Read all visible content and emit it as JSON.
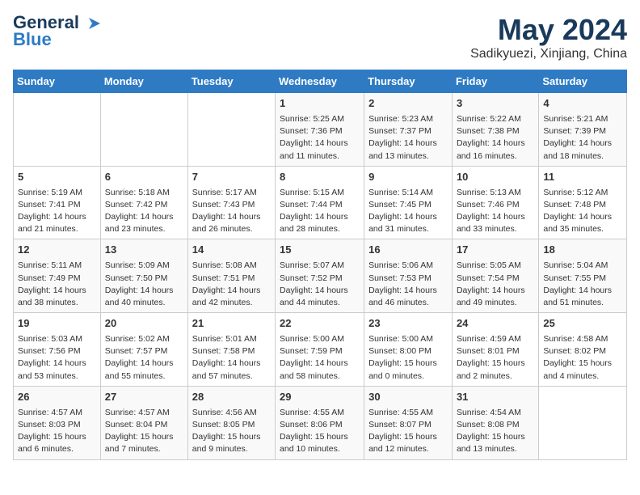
{
  "header": {
    "logo_line1": "General",
    "logo_line2": "Blue",
    "title": "May 2024",
    "location": "Sadikyuezi, Xinjiang, China"
  },
  "calendar": {
    "days_of_week": [
      "Sunday",
      "Monday",
      "Tuesday",
      "Wednesday",
      "Thursday",
      "Friday",
      "Saturday"
    ],
    "weeks": [
      [
        {
          "day": "",
          "info": ""
        },
        {
          "day": "",
          "info": ""
        },
        {
          "day": "",
          "info": ""
        },
        {
          "day": "1",
          "info": "Sunrise: 5:25 AM\nSunset: 7:36 PM\nDaylight: 14 hours\nand 11 minutes."
        },
        {
          "day": "2",
          "info": "Sunrise: 5:23 AM\nSunset: 7:37 PM\nDaylight: 14 hours\nand 13 minutes."
        },
        {
          "day": "3",
          "info": "Sunrise: 5:22 AM\nSunset: 7:38 PM\nDaylight: 14 hours\nand 16 minutes."
        },
        {
          "day": "4",
          "info": "Sunrise: 5:21 AM\nSunset: 7:39 PM\nDaylight: 14 hours\nand 18 minutes."
        }
      ],
      [
        {
          "day": "5",
          "info": "Sunrise: 5:19 AM\nSunset: 7:41 PM\nDaylight: 14 hours\nand 21 minutes."
        },
        {
          "day": "6",
          "info": "Sunrise: 5:18 AM\nSunset: 7:42 PM\nDaylight: 14 hours\nand 23 minutes."
        },
        {
          "day": "7",
          "info": "Sunrise: 5:17 AM\nSunset: 7:43 PM\nDaylight: 14 hours\nand 26 minutes."
        },
        {
          "day": "8",
          "info": "Sunrise: 5:15 AM\nSunset: 7:44 PM\nDaylight: 14 hours\nand 28 minutes."
        },
        {
          "day": "9",
          "info": "Sunrise: 5:14 AM\nSunset: 7:45 PM\nDaylight: 14 hours\nand 31 minutes."
        },
        {
          "day": "10",
          "info": "Sunrise: 5:13 AM\nSunset: 7:46 PM\nDaylight: 14 hours\nand 33 minutes."
        },
        {
          "day": "11",
          "info": "Sunrise: 5:12 AM\nSunset: 7:48 PM\nDaylight: 14 hours\nand 35 minutes."
        }
      ],
      [
        {
          "day": "12",
          "info": "Sunrise: 5:11 AM\nSunset: 7:49 PM\nDaylight: 14 hours\nand 38 minutes."
        },
        {
          "day": "13",
          "info": "Sunrise: 5:09 AM\nSunset: 7:50 PM\nDaylight: 14 hours\nand 40 minutes."
        },
        {
          "day": "14",
          "info": "Sunrise: 5:08 AM\nSunset: 7:51 PM\nDaylight: 14 hours\nand 42 minutes."
        },
        {
          "day": "15",
          "info": "Sunrise: 5:07 AM\nSunset: 7:52 PM\nDaylight: 14 hours\nand 44 minutes."
        },
        {
          "day": "16",
          "info": "Sunrise: 5:06 AM\nSunset: 7:53 PM\nDaylight: 14 hours\nand 46 minutes."
        },
        {
          "day": "17",
          "info": "Sunrise: 5:05 AM\nSunset: 7:54 PM\nDaylight: 14 hours\nand 49 minutes."
        },
        {
          "day": "18",
          "info": "Sunrise: 5:04 AM\nSunset: 7:55 PM\nDaylight: 14 hours\nand 51 minutes."
        }
      ],
      [
        {
          "day": "19",
          "info": "Sunrise: 5:03 AM\nSunset: 7:56 PM\nDaylight: 14 hours\nand 53 minutes."
        },
        {
          "day": "20",
          "info": "Sunrise: 5:02 AM\nSunset: 7:57 PM\nDaylight: 14 hours\nand 55 minutes."
        },
        {
          "day": "21",
          "info": "Sunrise: 5:01 AM\nSunset: 7:58 PM\nDaylight: 14 hours\nand 57 minutes."
        },
        {
          "day": "22",
          "info": "Sunrise: 5:00 AM\nSunset: 7:59 PM\nDaylight: 14 hours\nand 58 minutes."
        },
        {
          "day": "23",
          "info": "Sunrise: 5:00 AM\nSunset: 8:00 PM\nDaylight: 15 hours\nand 0 minutes."
        },
        {
          "day": "24",
          "info": "Sunrise: 4:59 AM\nSunset: 8:01 PM\nDaylight: 15 hours\nand 2 minutes."
        },
        {
          "day": "25",
          "info": "Sunrise: 4:58 AM\nSunset: 8:02 PM\nDaylight: 15 hours\nand 4 minutes."
        }
      ],
      [
        {
          "day": "26",
          "info": "Sunrise: 4:57 AM\nSunset: 8:03 PM\nDaylight: 15 hours\nand 6 minutes."
        },
        {
          "day": "27",
          "info": "Sunrise: 4:57 AM\nSunset: 8:04 PM\nDaylight: 15 hours\nand 7 minutes."
        },
        {
          "day": "28",
          "info": "Sunrise: 4:56 AM\nSunset: 8:05 PM\nDaylight: 15 hours\nand 9 minutes."
        },
        {
          "day": "29",
          "info": "Sunrise: 4:55 AM\nSunset: 8:06 PM\nDaylight: 15 hours\nand 10 minutes."
        },
        {
          "day": "30",
          "info": "Sunrise: 4:55 AM\nSunset: 8:07 PM\nDaylight: 15 hours\nand 12 minutes."
        },
        {
          "day": "31",
          "info": "Sunrise: 4:54 AM\nSunset: 8:08 PM\nDaylight: 15 hours\nand 13 minutes."
        },
        {
          "day": "",
          "info": ""
        }
      ]
    ]
  }
}
